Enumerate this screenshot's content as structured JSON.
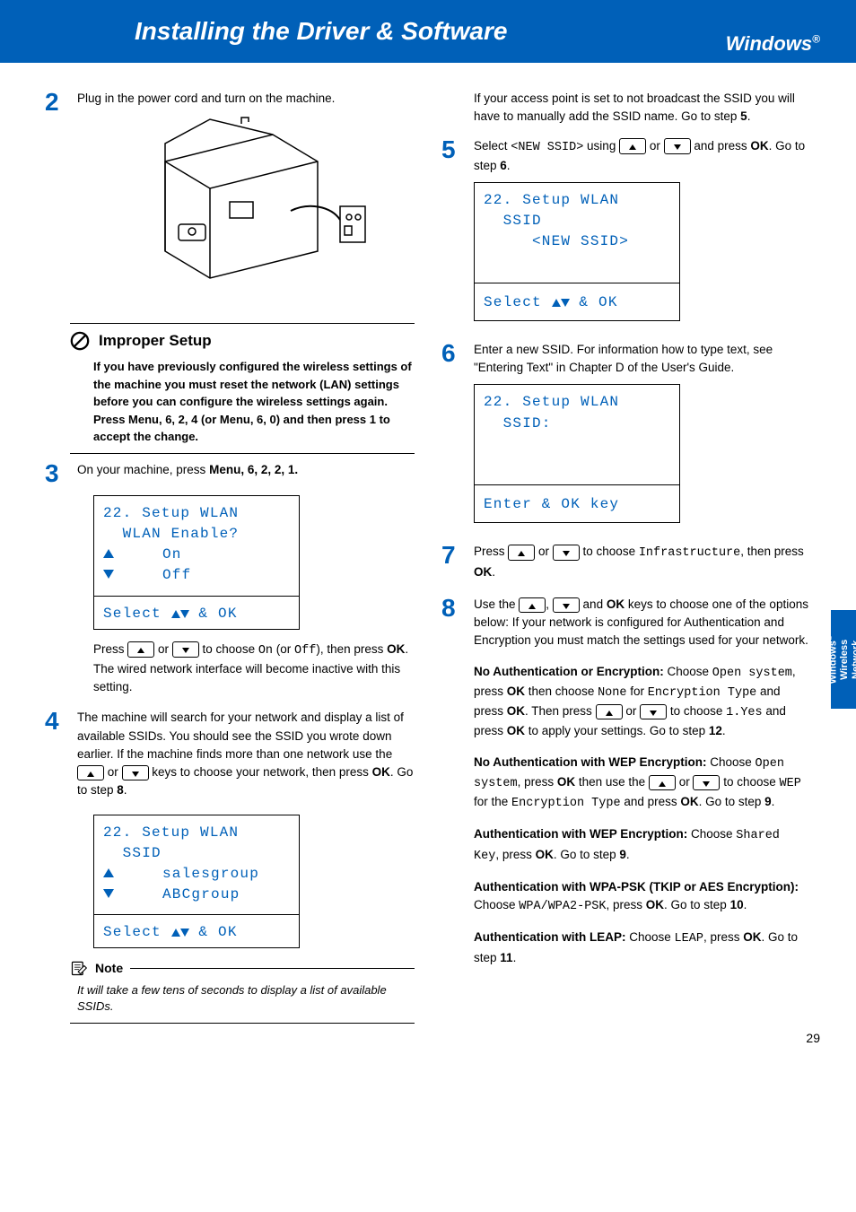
{
  "header": {
    "title": "Installing the Driver & Software",
    "os": "Windows",
    "os_reg": "®"
  },
  "side_tab": {
    "line1": "Windows",
    "reg": "®",
    "line2": "Wireless",
    "line3": "Network"
  },
  "page_number": "29",
  "left": {
    "s2": {
      "num": "2",
      "text": "Plug in the power cord and turn on the machine."
    },
    "warn": {
      "title": "Improper Setup",
      "body": "If you have previously configured the wireless settings of the machine you must reset the network (LAN) settings before you can configure the wireless settings again. Press Menu, 6, 2, 4 (or Menu, 6, 0) and then press 1 to accept the change."
    },
    "s3": {
      "num": "3",
      "intro_a": "On your machine, press ",
      "menu": "Menu",
      "seq": ", 6, 2, 2, 1.",
      "l1": "22. Setup WLAN",
      "l2": "  WLAN Enable?",
      "l3": "     On",
      "l4": "     Off",
      "foot": "Select ",
      "foot_b": " & OK",
      "p2a": "Press ",
      "p2b": " or ",
      "p2c": " to choose ",
      "on": "On",
      "p2d": " (or ",
      "off": "Off",
      "p2e": "), then press ",
      "ok": "OK",
      "p2f": ". The wired network interface will become inactive with this setting."
    },
    "s4": {
      "num": "4",
      "p1": "The machine will search for your network and display a list of available SSIDs. You should see the SSID you wrote down earlier. If the machine finds more than one network use the ",
      "p1b": " or ",
      "p1c": " keys to choose your network, then press ",
      "ok": "OK",
      "p1d": ". Go to step ",
      "step": "8",
      "p1e": ".",
      "l1": "22. Setup WLAN",
      "l2": "  SSID",
      "l3": "     salesgroup",
      "l4": "     ABCgroup",
      "foot": "Select ",
      "foot_b": " & OK"
    },
    "note": {
      "title": "Note",
      "body": "It will take a few tens of seconds to display a list of available SSIDs."
    }
  },
  "right": {
    "cont": {
      "a": "If your access point is set to not broadcast the SSID you will have to manually add the SSID name. Go to step ",
      "step": "5",
      "b": "."
    },
    "s5": {
      "num": "5",
      "a": "Select ",
      "ssid": "<NEW SSID>",
      "b": " using ",
      "c": " or ",
      "d": " and press ",
      "ok": "OK",
      "e": ". Go to step ",
      "step": "6",
      "f": ".",
      "l1": "22. Setup WLAN",
      "l2": "  SSID",
      "l3": "     <NEW SSID>",
      "foot": "Select ",
      "foot_b": " & OK"
    },
    "s6": {
      "num": "6",
      "p": "Enter a new SSID. For information how to type text, see \"Entering Text\" in Chapter D of the User's Guide.",
      "l1": "22. Setup WLAN",
      "l2": "  SSID:",
      "foot": "Enter & OK key"
    },
    "s7": {
      "num": "7",
      "a": "Press ",
      "b": " or ",
      "c": " to choose ",
      "infra": "Infrastructure",
      "d": ", then press ",
      "ok": "OK",
      "e": "."
    },
    "s8": {
      "num": "8",
      "a": "Use the ",
      "b": ", ",
      "c": " and ",
      "ok": "OK",
      "d": " keys to choose one of the options below: If your network is configured for Authentication and Encryption you must match the settings used for your network.",
      "o1t": "No Authentication or Encryption:",
      "o1a": " Choose ",
      "o1open": "Open system",
      "o1b": ", press ",
      "o1ok": "OK",
      "o1c": " then choose ",
      "o1none": "None",
      "o1d": " for ",
      "o1et": "Encryption Type",
      "o1e": " and press ",
      "o1ok2": "OK",
      "o1f": ". Then press ",
      "o1g": " or ",
      "o1h": " to choose ",
      "o1yes": "1.Yes",
      "o1i": " and press ",
      "o1ok3": "OK",
      "o1j": " to apply your settings. Go to step ",
      "o1step": "12",
      "o1k": ".",
      "o2t": "No Authentication with WEP Encryption:",
      "o2a": " Choose ",
      "o2open": "Open system",
      "o2b": ", press ",
      "o2ok": "OK",
      "o2c": " then use the ",
      "o2d": " or ",
      "o2e": " to choose ",
      "o2wep": "WEP",
      "o2f": " for the ",
      "o2et": "Encryption Type",
      "o2g": " and press ",
      "o2ok2": "OK",
      "o2h": ". Go to step ",
      "o2step": "9",
      "o2i": ".",
      "o3t": "Authentication with WEP Encryption:",
      "o3a": " Choose ",
      "o3sk": "Shared Key",
      "o3b": ", press ",
      "o3ok": "OK",
      "o3c": ". Go to step ",
      "o3step": "9",
      "o3d": ".",
      "o4t": "Authentication with WPA-PSK (TKIP or AES Encryption):",
      "o4a": " Choose ",
      "o4w": "WPA/WPA2-PSK",
      "o4b": ", press ",
      "o4ok": "OK",
      "o4c": ". Go to step ",
      "o4step": "10",
      "o4d": ".",
      "o5t": "Authentication with LEAP:",
      "o5a": " Choose ",
      "o5l": "LEAP",
      "o5b": ", press ",
      "o5ok": "OK",
      "o5c": ". Go to step ",
      "o5step": "11",
      "o5d": "."
    }
  }
}
